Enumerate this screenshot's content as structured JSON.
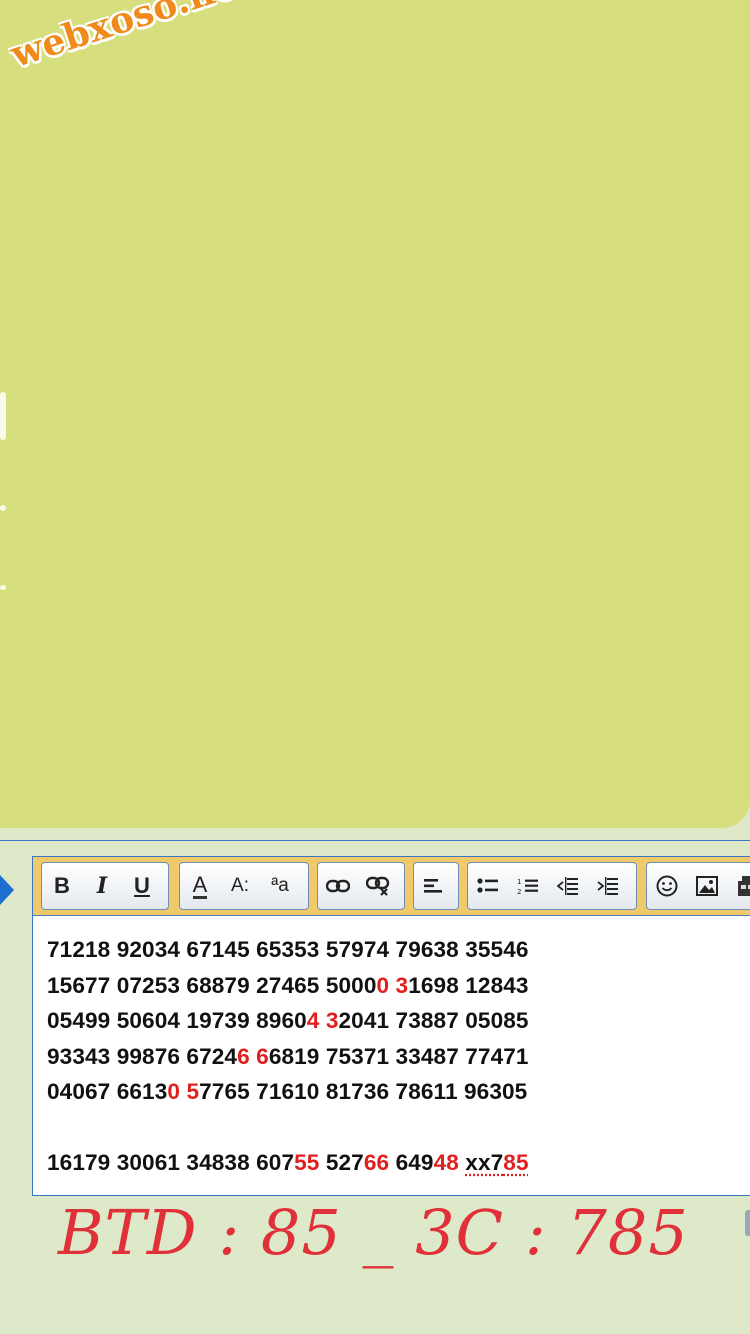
{
  "watermark": "webxoso.net",
  "toolbar": {
    "bold_label": "B",
    "italic_label": "I",
    "underline_label": "U",
    "font_color_label": "A",
    "font_size_label": "A:",
    "font_family_label": "ªa",
    "icons": [
      "bold-icon",
      "italic-icon",
      "underline-icon",
      "font-color-icon",
      "font-size-icon",
      "font-family-icon",
      "link-icon",
      "unlink-icon",
      "align-left-icon",
      "bulleted-list-icon",
      "numbered-list-icon",
      "outdent-icon",
      "indent-icon",
      "emoji-icon",
      "image-icon",
      "media-icon"
    ]
  },
  "content": {
    "rows": [
      [
        {
          "t": "71218 92034 67145 65353 57974 79638 35546"
        }
      ],
      [
        {
          "t": "15677 07253 68879 27465 5000"
        },
        {
          "t": "0",
          "hl": true
        },
        {
          "t": " "
        },
        {
          "t": "3",
          "hl": true
        },
        {
          "t": "1698 12843"
        }
      ],
      [
        {
          "t": "05499 50604 19739 8960"
        },
        {
          "t": "4",
          "hl": true
        },
        {
          "t": " "
        },
        {
          "t": "3",
          "hl": true
        },
        {
          "t": "2041 73887 05085"
        }
      ],
      [
        {
          "t": "93343 99876 6724"
        },
        {
          "t": "6",
          "hl": true
        },
        {
          "t": " "
        },
        {
          "t": "6",
          "hl": true
        },
        {
          "t": "6819 75371 33487 77471"
        }
      ],
      [
        {
          "t": "04067 6613"
        },
        {
          "t": "0",
          "hl": true
        },
        {
          "t": " "
        },
        {
          "t": "5",
          "hl": true
        },
        {
          "t": "7765 71610 81736 78611 96305"
        }
      ],
      [],
      [
        {
          "t": "16179 30061 34838 607"
        },
        {
          "t": "55",
          "hl": true
        },
        {
          "t": " 527"
        },
        {
          "t": "66",
          "hl": true
        },
        {
          "t": " 649"
        },
        {
          "t": "48",
          "hl": true
        },
        {
          "t": " "
        },
        {
          "t": "xx7",
          "sq": true
        },
        {
          "t": "85",
          "hl": true,
          "sq": true
        }
      ]
    ]
  },
  "caption": "BTD : 85 _ 3C : 785",
  "colors": {
    "panel": "#d6de7e",
    "background": "#dde9c8",
    "toolbar": "#efc96a",
    "highlight": "#e0201e",
    "caption": "#e0313a",
    "watermark": "#f08a1c",
    "border": "#3a77c9"
  }
}
